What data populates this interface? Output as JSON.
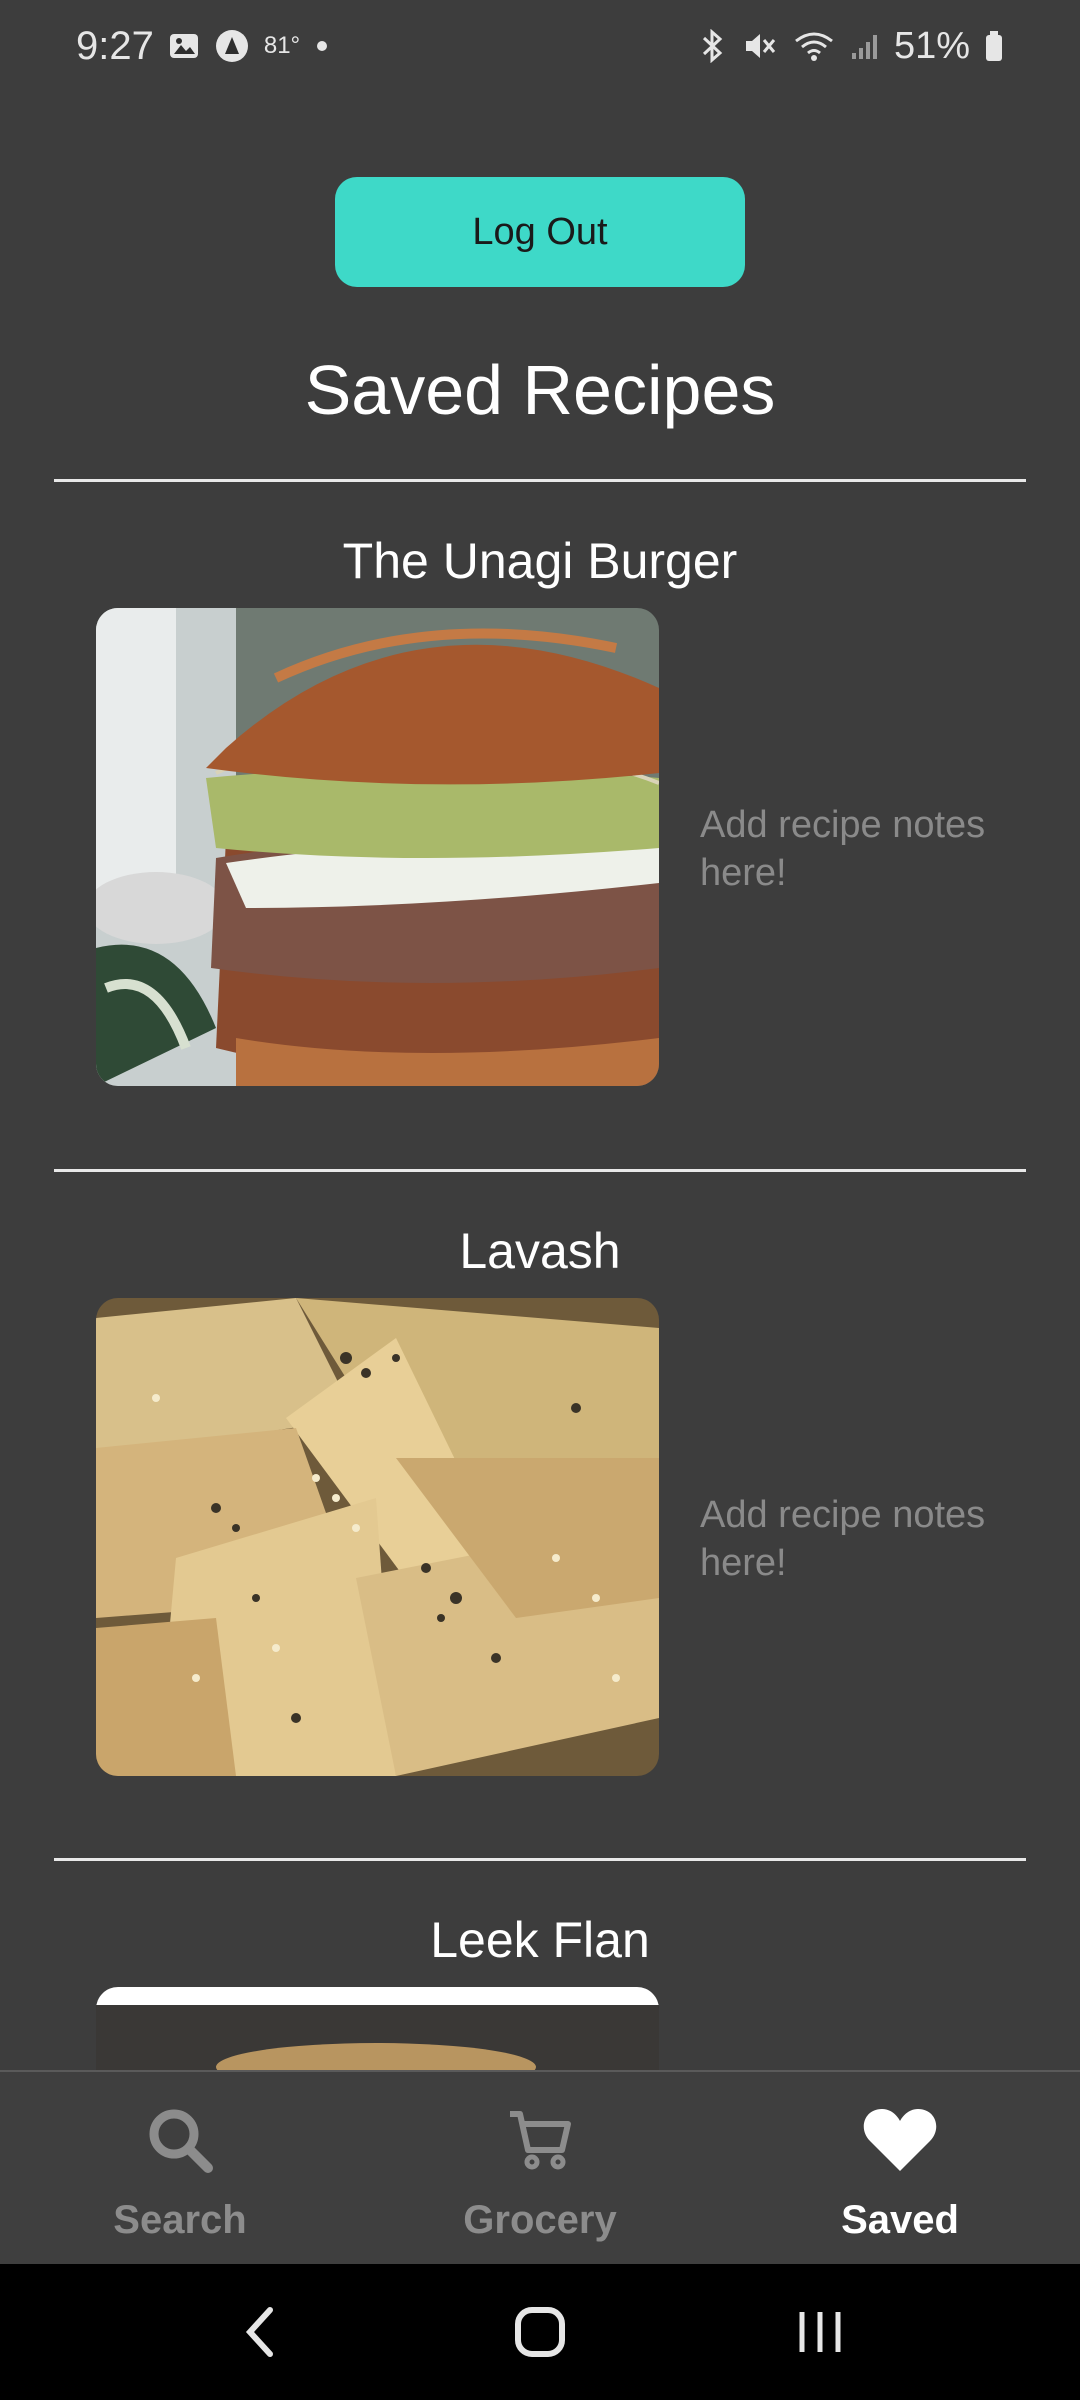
{
  "status_bar": {
    "time": "9:27",
    "temperature": "81°",
    "battery": "51%"
  },
  "header": {
    "logout_label": "Log Out",
    "title": "Saved Recipes"
  },
  "recipes": [
    {
      "title": "The Unagi Burger",
      "notes_placeholder": "Add recipe notes here!"
    },
    {
      "title": "Lavash",
      "notes_placeholder": "Add recipe notes here!"
    },
    {
      "title": "Leek Flan",
      "notes_placeholder": ""
    }
  ],
  "bottom_nav": {
    "items": [
      {
        "label": "Search",
        "icon": "search-icon",
        "active": false
      },
      {
        "label": "Grocery",
        "icon": "cart-icon",
        "active": false
      },
      {
        "label": "Saved",
        "icon": "heart-icon",
        "active": true
      }
    ]
  },
  "colors": {
    "background": "#3d3d3d",
    "accent": "#3ed9c8",
    "inactive": "#8c8c8c"
  }
}
